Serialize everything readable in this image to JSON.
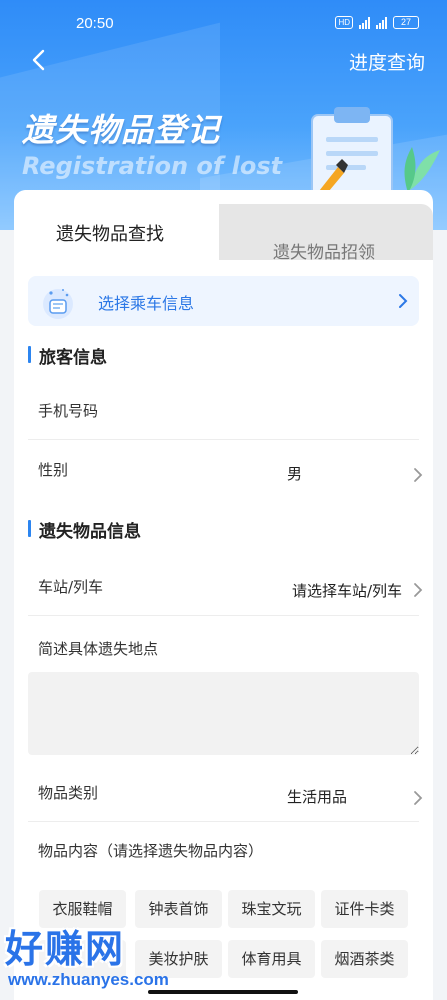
{
  "status_bar": {
    "time": "20:50",
    "hd": "HD",
    "net1": "4G",
    "net2": "4G",
    "battery": "27"
  },
  "header": {
    "back_icon": "chevron-left-icon",
    "right_link": "进度查询",
    "title": "遗失物品登记",
    "subtitle": "Registration of lost"
  },
  "tabs": [
    {
      "label": "遗失物品查找",
      "active": true
    },
    {
      "label": "遗失物品招领",
      "active": false
    }
  ],
  "select_train": {
    "label": "选择乘车信息",
    "icon": "passenger-icon"
  },
  "passenger_section": {
    "title": "旅客信息",
    "phone_label": "手机号码",
    "gender_label": "性别",
    "gender_value": "男"
  },
  "item_section": {
    "title": "遗失物品信息",
    "station_label": "车站/列车",
    "station_placeholder": "请选择车站/列车",
    "location_label": "简述具体遗失地点",
    "category_label": "物品类别",
    "category_value": "生活用品",
    "content_label": "物品内容（请选择遗失物品内容）",
    "chips": [
      "衣服鞋帽",
      "钟表首饰",
      "珠宝文玩",
      "证件卡类",
      "",
      "美妆护肤",
      "体育用具",
      "烟酒茶类"
    ]
  },
  "watermark": {
    "title": "好赚网",
    "url": "www.zhuanyes.com"
  },
  "colors": {
    "accent": "#2c85f0",
    "header_top": "#2f8cf8"
  }
}
